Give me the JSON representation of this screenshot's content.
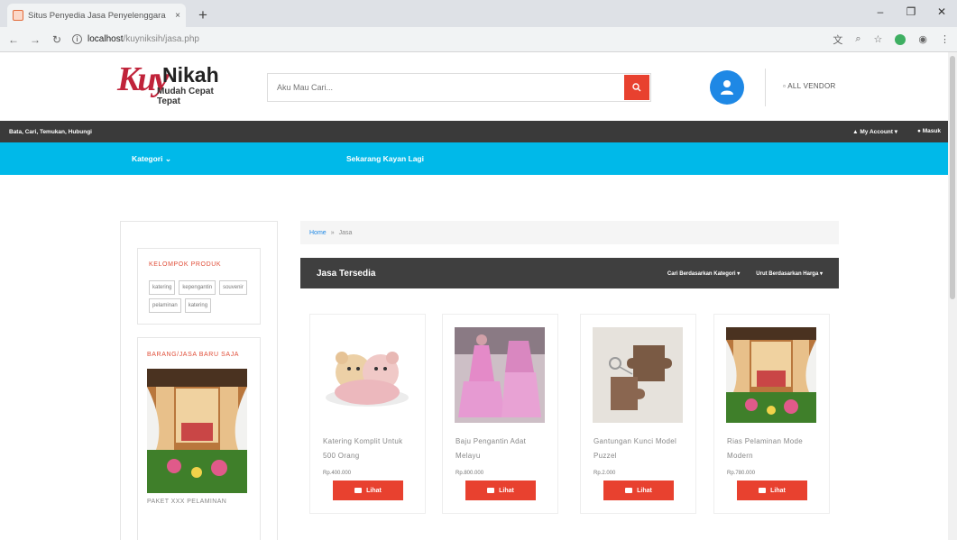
{
  "browser": {
    "tab_title": "Situs Penyedia Jasa Penyelenggara",
    "url_host": "localhost",
    "url_path": "/kuyniksih/jasa.php",
    "new_tab": "+",
    "close_tab": "×"
  },
  "header": {
    "logo_mark": "Kuy",
    "logo_name": "Nikah",
    "logo_tagline": "Mudah Cepat Tepat",
    "search_placeholder": "Aku Mau Cari...",
    "all_vendor": "ALL VENDOR"
  },
  "topbar": {
    "tagline": "Bata, Cari, Temukan, Hubungi",
    "my_account": "My Account",
    "masuk": "Masuk"
  },
  "nav": {
    "kategori": "Kategori",
    "sekarang": "Sekarang Kayan Lagi"
  },
  "sidebar": {
    "group_title": "KELOMPOK PRODUK",
    "tags": [
      "katering",
      "kepengantin",
      "souvenir",
      "pelaminan",
      "katering"
    ],
    "new_title": "BARANG/JASA BARU SAJA",
    "new_caption": "PAKET XXX PELAMINAN"
  },
  "breadcrumb": {
    "home": "Home",
    "sep": "»",
    "current": "Jasa"
  },
  "products": {
    "title": "Jasa Tersedia",
    "filter_kategori": "Cari Berdasarkan Kategori",
    "filter_harga": "Urut Berdasarkan Harga",
    "button_label": "Lihat",
    "items": [
      {
        "name": "Katering Komplit Untuk 500 Orang",
        "price": "Rp.400.000"
      },
      {
        "name": "Baju Pengantin Adat Melayu",
        "price": "Rp.800.000"
      },
      {
        "name": "Gantungan Kunci Model Puzzel",
        "price": "Rp.2.000"
      },
      {
        "name": "Rias Pelaminan Mode Modern",
        "price": "Rp.780.000"
      }
    ]
  },
  "colors": {
    "accent_red": "#e8412f",
    "cyan": "#00b9e9",
    "dark": "#3a3a3a",
    "blue": "#1e88e5"
  }
}
